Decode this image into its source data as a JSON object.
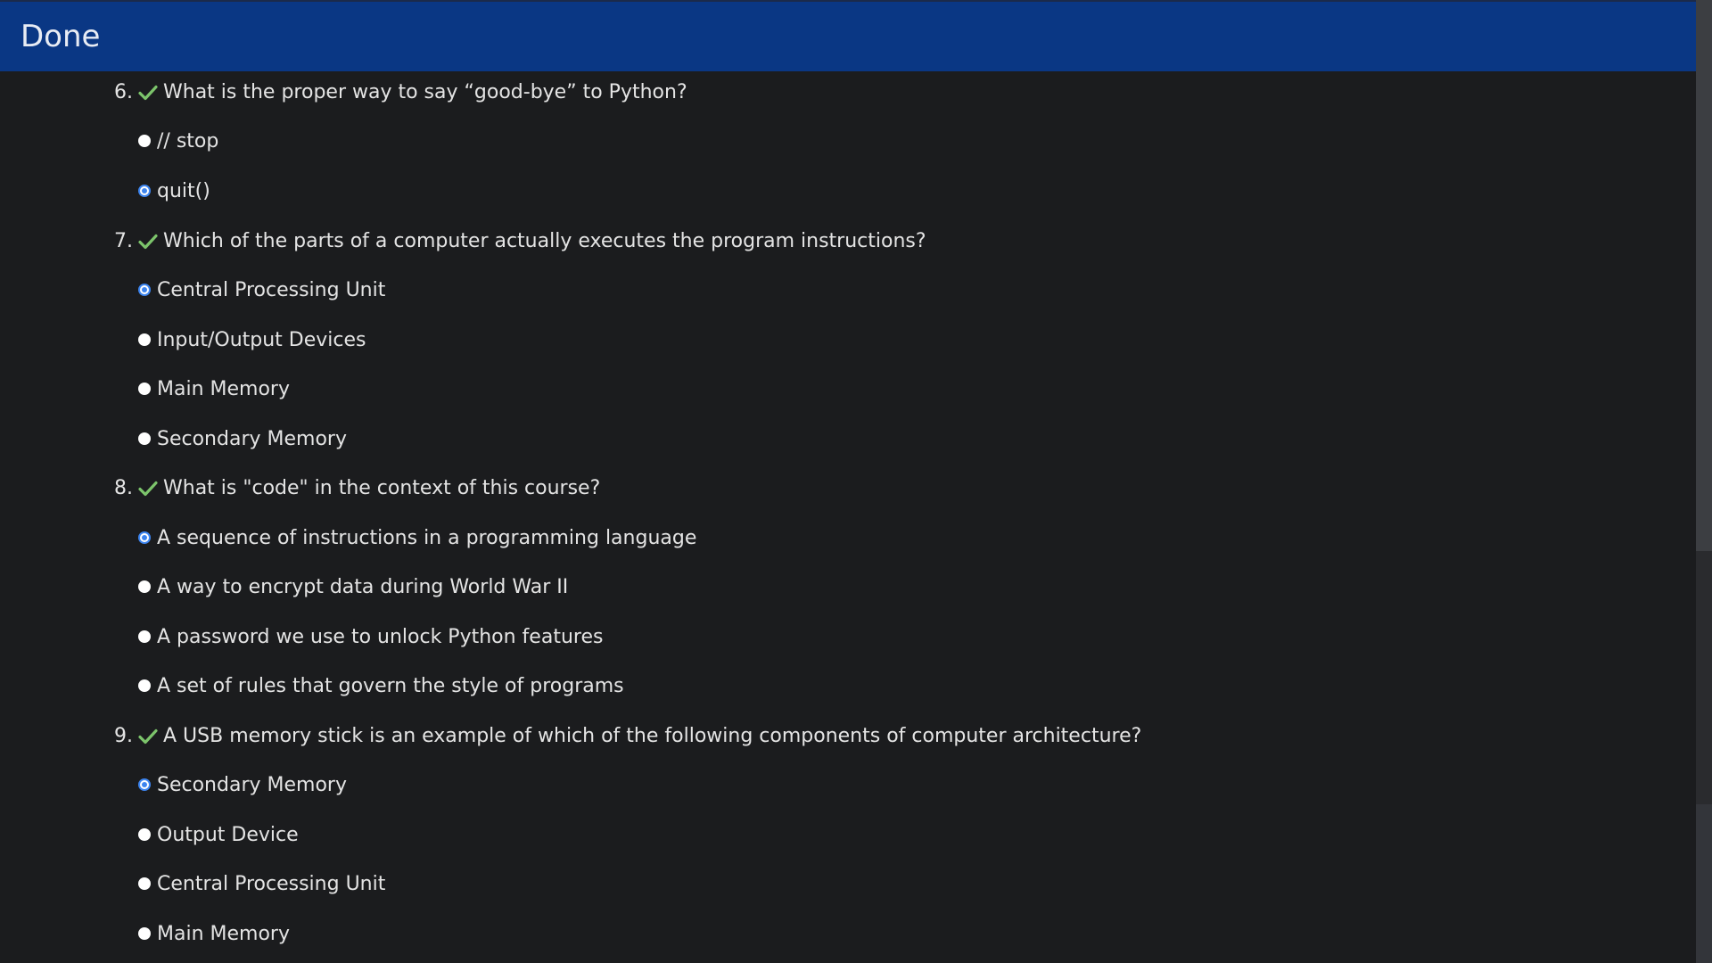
{
  "header": {
    "title": "Done"
  },
  "colors": {
    "header_bg": "#0a3784",
    "page_bg": "#1b1c1e",
    "check": "#7cc46b",
    "radio_selected": "#3d85f0"
  },
  "questions": [
    {
      "number": "6.",
      "text": "What is the proper way to say “good-bye” to Python?",
      "correct": true,
      "options": [
        {
          "label": "// stop",
          "selected": false
        },
        {
          "label": "quit()",
          "selected": true
        }
      ]
    },
    {
      "number": "7.",
      "text": "Which of the parts of a computer actually executes the program instructions?",
      "correct": true,
      "options": [
        {
          "label": "Central Processing Unit",
          "selected": true
        },
        {
          "label": "Input/Output Devices",
          "selected": false
        },
        {
          "label": "Main Memory",
          "selected": false
        },
        {
          "label": "Secondary Memory",
          "selected": false
        }
      ]
    },
    {
      "number": "8.",
      "text": "What is \"code\" in the context of this course?",
      "correct": true,
      "options": [
        {
          "label": "A sequence of instructions in a programming language",
          "selected": true
        },
        {
          "label": "A way to encrypt data during World War II",
          "selected": false
        },
        {
          "label": "A password we use to unlock Python features",
          "selected": false
        },
        {
          "label": "A set of rules that govern the style of programs",
          "selected": false
        }
      ]
    },
    {
      "number": "9.",
      "text": "A USB memory stick is an example of which of the following components of computer architecture?",
      "correct": true,
      "options": [
        {
          "label": "Secondary Memory",
          "selected": true
        },
        {
          "label": "Output Device",
          "selected": false
        },
        {
          "label": "Central Processing Unit",
          "selected": false
        },
        {
          "label": "Main Memory",
          "selected": false
        }
      ]
    }
  ]
}
